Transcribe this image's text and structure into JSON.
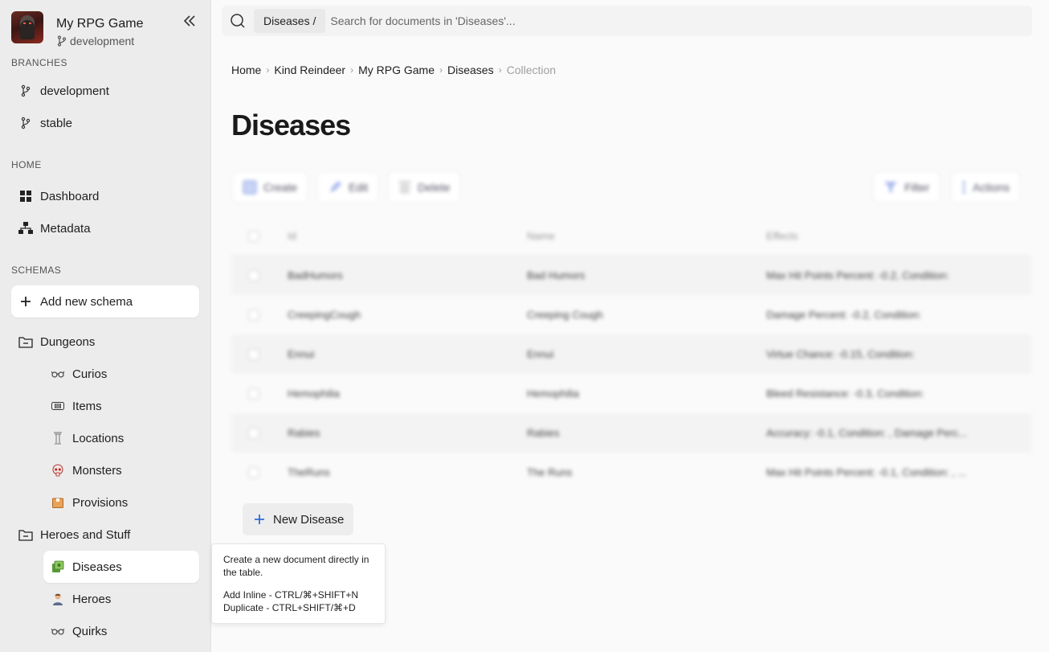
{
  "app": {
    "title": "My RPG Game",
    "current_branch": "development"
  },
  "sidebar": {
    "branches_label": "BRANCHES",
    "branches": [
      {
        "label": "development"
      },
      {
        "label": "stable"
      }
    ],
    "home_label": "HOME",
    "home_items": [
      {
        "label": "Dashboard",
        "icon": "dashboard-icon"
      },
      {
        "label": "Metadata",
        "icon": "metadata-icon"
      }
    ],
    "schemas_label": "SCHEMAS",
    "add_schema_label": "Add new schema",
    "groups": [
      {
        "label": "Dungeons",
        "items": [
          {
            "label": "Curios",
            "icon": "goggles-icon"
          },
          {
            "label": "Items",
            "icon": "bandage-icon"
          },
          {
            "label": "Locations",
            "icon": "pillar-icon"
          },
          {
            "label": "Monsters",
            "icon": "skull-icon"
          },
          {
            "label": "Provisions",
            "icon": "box-icon"
          }
        ]
      },
      {
        "label": "Heroes and Stuff",
        "items": [
          {
            "label": "Diseases",
            "icon": "disease-icon",
            "active": true
          },
          {
            "label": "Heroes",
            "icon": "hero-icon"
          },
          {
            "label": "Quirks",
            "icon": "goggles-icon"
          }
        ]
      }
    ]
  },
  "search": {
    "scope": "Diseases /",
    "placeholder": "Search for documents in 'Diseases'..."
  },
  "breadcrumb": [
    "Home",
    "Kind Reindeer",
    "My RPG Game",
    "Diseases",
    "Collection"
  ],
  "page_title": "Diseases",
  "toolbar": {
    "create": "Create",
    "edit": "Edit",
    "delete": "Delete",
    "filter": "Filter",
    "actions": "Actions"
  },
  "table": {
    "columns": [
      "Id",
      "Name",
      "Effects"
    ],
    "rows": [
      {
        "id": "BadHumors",
        "name": "Bad Humors",
        "effects": "Max Hit Points Percent: -0.2, Condition:"
      },
      {
        "id": "CreepingCough",
        "name": "Creeping Cough",
        "effects": "Damage Percent: -0.2, Condition:"
      },
      {
        "id": "Ennui",
        "name": "Ennui",
        "effects": "Virtue Chance: -0.15, Condition:"
      },
      {
        "id": "Hemophilia",
        "name": "Hemophilia",
        "effects": "Bleed Resistance: -0.3, Condition:"
      },
      {
        "id": "Rabies",
        "name": "Rabies",
        "effects": "Accuracy: -0.1, Condition: , Damage Perc..."
      },
      {
        "id": "TheRuns",
        "name": "The Runs",
        "effects": "Max Hit Points Percent: -0.1, Condition: , ..."
      }
    ]
  },
  "new_button_label": "New Disease",
  "tooltip": {
    "line1": "Create a new document directly in the table.",
    "line2": "Add Inline - CTRL/⌘+SHIFT+N",
    "line3": "Duplicate - CTRL+SHIFT/⌘+D"
  },
  "colors": {
    "sidebar_bg": "#ececec",
    "accent": "#2f6fd6",
    "main_bg": "#fafafa"
  }
}
